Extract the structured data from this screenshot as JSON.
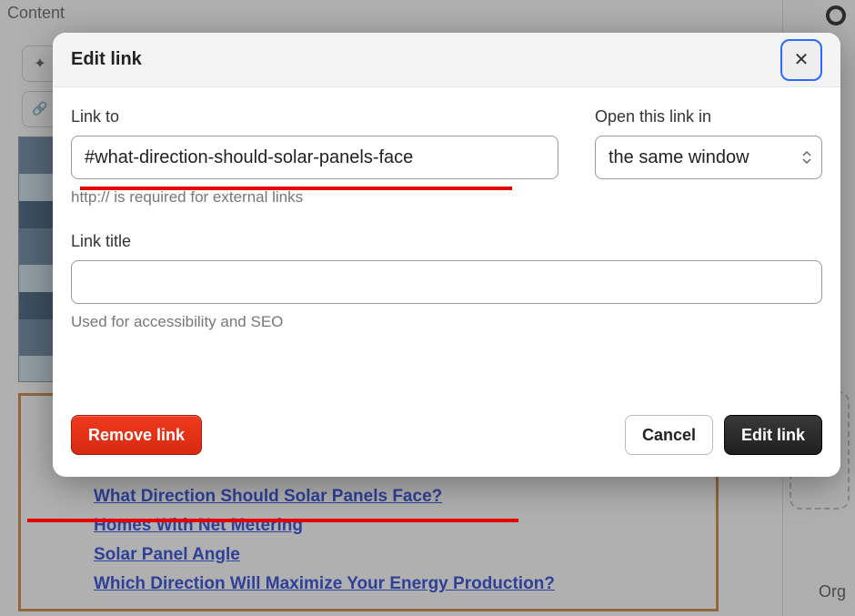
{
  "bg": {
    "content_label": "Content",
    "right_org": "Org",
    "toc_links": [
      "What Direction Should Solar Panels Face?",
      "Homes With Net Metering",
      "Solar Panel Angle",
      "Which Direction Will Maximize Your Energy Production?"
    ]
  },
  "modal": {
    "title": "Edit link",
    "link_to_label": "Link to",
    "link_to_value": "#what-direction-should-solar-panels-face",
    "link_to_helper": "http:// is required for external links",
    "open_in_label": "Open this link in",
    "open_in_value": "the same window",
    "link_title_label": "Link title",
    "link_title_value": "",
    "link_title_helper": "Used for accessibility and SEO",
    "remove_label": "Remove link",
    "cancel_label": "Cancel",
    "submit_label": "Edit link",
    "close_glyph": "✕"
  }
}
